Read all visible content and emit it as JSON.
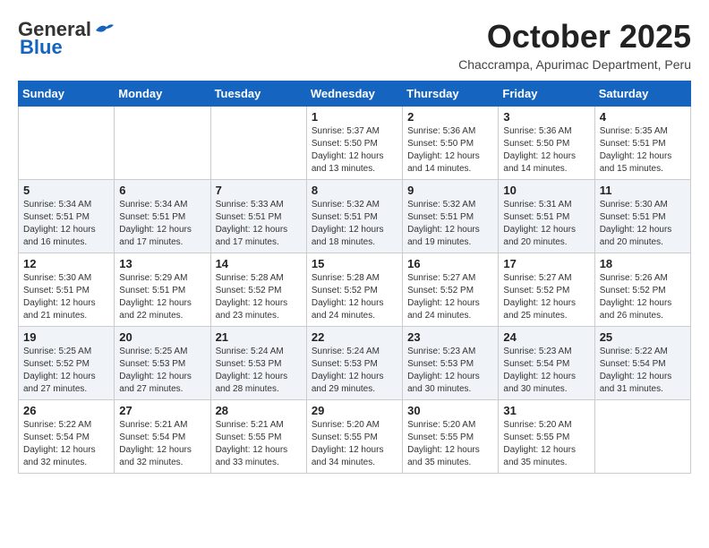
{
  "header": {
    "logo_general": "General",
    "logo_blue": "Blue",
    "month": "October 2025",
    "location": "Chaccrampa, Apurimac Department, Peru"
  },
  "days_of_week": [
    "Sunday",
    "Monday",
    "Tuesday",
    "Wednesday",
    "Thursday",
    "Friday",
    "Saturday"
  ],
  "weeks": [
    [
      {
        "day": "",
        "info": ""
      },
      {
        "day": "",
        "info": ""
      },
      {
        "day": "",
        "info": ""
      },
      {
        "day": "1",
        "info": "Sunrise: 5:37 AM\nSunset: 5:50 PM\nDaylight: 12 hours\nand 13 minutes."
      },
      {
        "day": "2",
        "info": "Sunrise: 5:36 AM\nSunset: 5:50 PM\nDaylight: 12 hours\nand 14 minutes."
      },
      {
        "day": "3",
        "info": "Sunrise: 5:36 AM\nSunset: 5:50 PM\nDaylight: 12 hours\nand 14 minutes."
      },
      {
        "day": "4",
        "info": "Sunrise: 5:35 AM\nSunset: 5:51 PM\nDaylight: 12 hours\nand 15 minutes."
      }
    ],
    [
      {
        "day": "5",
        "info": "Sunrise: 5:34 AM\nSunset: 5:51 PM\nDaylight: 12 hours\nand 16 minutes."
      },
      {
        "day": "6",
        "info": "Sunrise: 5:34 AM\nSunset: 5:51 PM\nDaylight: 12 hours\nand 17 minutes."
      },
      {
        "day": "7",
        "info": "Sunrise: 5:33 AM\nSunset: 5:51 PM\nDaylight: 12 hours\nand 17 minutes."
      },
      {
        "day": "8",
        "info": "Sunrise: 5:32 AM\nSunset: 5:51 PM\nDaylight: 12 hours\nand 18 minutes."
      },
      {
        "day": "9",
        "info": "Sunrise: 5:32 AM\nSunset: 5:51 PM\nDaylight: 12 hours\nand 19 minutes."
      },
      {
        "day": "10",
        "info": "Sunrise: 5:31 AM\nSunset: 5:51 PM\nDaylight: 12 hours\nand 20 minutes."
      },
      {
        "day": "11",
        "info": "Sunrise: 5:30 AM\nSunset: 5:51 PM\nDaylight: 12 hours\nand 20 minutes."
      }
    ],
    [
      {
        "day": "12",
        "info": "Sunrise: 5:30 AM\nSunset: 5:51 PM\nDaylight: 12 hours\nand 21 minutes."
      },
      {
        "day": "13",
        "info": "Sunrise: 5:29 AM\nSunset: 5:51 PM\nDaylight: 12 hours\nand 22 minutes."
      },
      {
        "day": "14",
        "info": "Sunrise: 5:28 AM\nSunset: 5:52 PM\nDaylight: 12 hours\nand 23 minutes."
      },
      {
        "day": "15",
        "info": "Sunrise: 5:28 AM\nSunset: 5:52 PM\nDaylight: 12 hours\nand 24 minutes."
      },
      {
        "day": "16",
        "info": "Sunrise: 5:27 AM\nSunset: 5:52 PM\nDaylight: 12 hours\nand 24 minutes."
      },
      {
        "day": "17",
        "info": "Sunrise: 5:27 AM\nSunset: 5:52 PM\nDaylight: 12 hours\nand 25 minutes."
      },
      {
        "day": "18",
        "info": "Sunrise: 5:26 AM\nSunset: 5:52 PM\nDaylight: 12 hours\nand 26 minutes."
      }
    ],
    [
      {
        "day": "19",
        "info": "Sunrise: 5:25 AM\nSunset: 5:52 PM\nDaylight: 12 hours\nand 27 minutes."
      },
      {
        "day": "20",
        "info": "Sunrise: 5:25 AM\nSunset: 5:53 PM\nDaylight: 12 hours\nand 27 minutes."
      },
      {
        "day": "21",
        "info": "Sunrise: 5:24 AM\nSunset: 5:53 PM\nDaylight: 12 hours\nand 28 minutes."
      },
      {
        "day": "22",
        "info": "Sunrise: 5:24 AM\nSunset: 5:53 PM\nDaylight: 12 hours\nand 29 minutes."
      },
      {
        "day": "23",
        "info": "Sunrise: 5:23 AM\nSunset: 5:53 PM\nDaylight: 12 hours\nand 30 minutes."
      },
      {
        "day": "24",
        "info": "Sunrise: 5:23 AM\nSunset: 5:54 PM\nDaylight: 12 hours\nand 30 minutes."
      },
      {
        "day": "25",
        "info": "Sunrise: 5:22 AM\nSunset: 5:54 PM\nDaylight: 12 hours\nand 31 minutes."
      }
    ],
    [
      {
        "day": "26",
        "info": "Sunrise: 5:22 AM\nSunset: 5:54 PM\nDaylight: 12 hours\nand 32 minutes."
      },
      {
        "day": "27",
        "info": "Sunrise: 5:21 AM\nSunset: 5:54 PM\nDaylight: 12 hours\nand 32 minutes."
      },
      {
        "day": "28",
        "info": "Sunrise: 5:21 AM\nSunset: 5:55 PM\nDaylight: 12 hours\nand 33 minutes."
      },
      {
        "day": "29",
        "info": "Sunrise: 5:20 AM\nSunset: 5:55 PM\nDaylight: 12 hours\nand 34 minutes."
      },
      {
        "day": "30",
        "info": "Sunrise: 5:20 AM\nSunset: 5:55 PM\nDaylight: 12 hours\nand 35 minutes."
      },
      {
        "day": "31",
        "info": "Sunrise: 5:20 AM\nSunset: 5:55 PM\nDaylight: 12 hours\nand 35 minutes."
      },
      {
        "day": "",
        "info": ""
      }
    ]
  ]
}
